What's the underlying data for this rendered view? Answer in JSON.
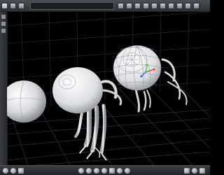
{
  "app": {
    "title": "",
    "toolbar": {
      "icons": [
        "select-icon",
        "move-icon",
        "rotate-icon",
        "scale-icon",
        "camera-icon",
        "light-icon",
        "render-icon",
        "grid-icon",
        "material-icon",
        "pose-icon",
        "morph-icon",
        "settings-icon",
        "display-icon"
      ],
      "field_value": ""
    },
    "left_strip": {
      "icons": [
        "view-front-icon",
        "view-top-icon",
        "view-side-icon"
      ]
    },
    "viewport": {
      "background": "#000000",
      "grid_color": "#3a3a3a",
      "objects": [
        "eyeball-plain",
        "eyeball-with-tentacles",
        "eyeball-wireframe-selected"
      ],
      "gizmo_colors": {
        "x": "#ff3030",
        "y": "#30d030",
        "z": "#3050ff"
      }
    },
    "statusbar": {
      "left_icons": [
        "play-icon",
        "record-icon",
        "keyframe-icon",
        "camera-icon",
        "zoom-icon",
        "pan-icon",
        "orbit-icon",
        "frame-icon",
        "home-icon",
        "light-icon"
      ],
      "right_icons": [
        "render-icon",
        "settings-icon",
        "layout-icon"
      ]
    }
  }
}
